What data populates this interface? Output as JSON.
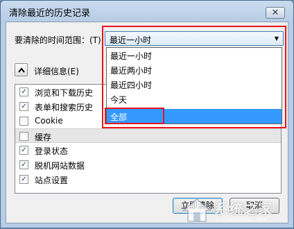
{
  "window": {
    "title": "清除最近的历史记录",
    "close_glyph": "✕"
  },
  "range": {
    "label": "要清除的时间范围：(T)",
    "selected": "最近一小时"
  },
  "dropdown": {
    "options": [
      "最近一小时",
      "最近两小时",
      "最近四小时",
      "今天",
      "全部"
    ],
    "highlighted_index": 4
  },
  "details": {
    "label": "详细信息(E)"
  },
  "items": [
    {
      "label": "浏览和下载历史",
      "checked": true
    },
    {
      "label": "表单和搜索历史",
      "checked": true
    },
    {
      "label": "Cookie",
      "checked": false
    },
    {
      "label": "缓存",
      "checked": false
    },
    {
      "label": "登录状态",
      "checked": true
    },
    {
      "label": "脱机网站数据",
      "checked": true
    },
    {
      "label": "站点设置",
      "checked": true
    }
  ],
  "buttons": {
    "clear": "立即清除",
    "cancel": "取消"
  },
  "watermark": {
    "text": "系统之家",
    "sub": "XITONGZHIJIA.NET"
  },
  "colors": {
    "highlight": "#3399ff",
    "annotation_red": "#e8141b"
  }
}
